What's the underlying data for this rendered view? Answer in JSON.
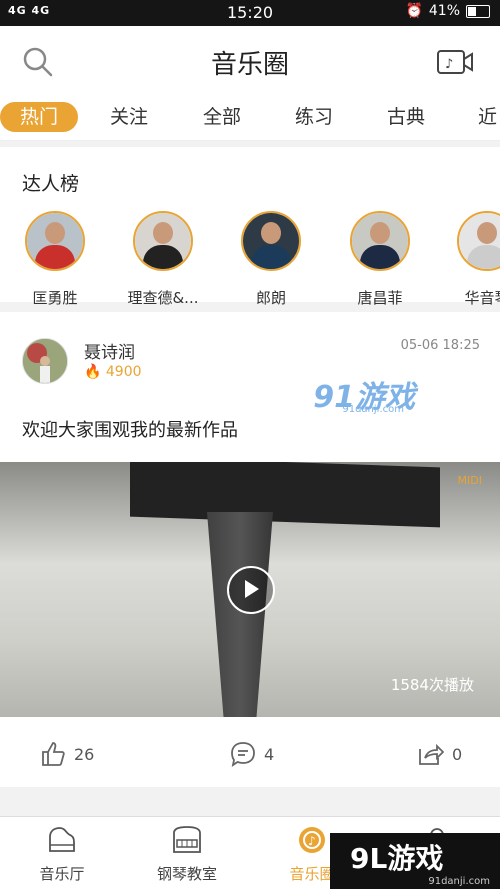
{
  "status": {
    "signal": "4G 4G",
    "time": "15:20",
    "battery": "41%"
  },
  "header": {
    "title": "音乐圈"
  },
  "tabs": [
    "热门",
    "关注",
    "全部",
    "练习",
    "古典",
    "近"
  ],
  "talent": {
    "title": "达人榜",
    "people": [
      {
        "name": "匡勇胜",
        "color": "#c9302c",
        "bg": "#b9c2c8"
      },
      {
        "name": "理查德&...",
        "color": "#222222",
        "bg": "#d8d4cf"
      },
      {
        "name": "郎朗",
        "color": "#1c3a5a",
        "bg": "#2e3b46"
      },
      {
        "name": "唐昌菲",
        "color": "#1c2a44",
        "bg": "#c9c9c4"
      },
      {
        "name": "华音琴",
        "color": "#cccccc",
        "bg": "#e5e5e5"
      }
    ]
  },
  "post": {
    "user": "聂诗润",
    "fire": "4900",
    "time": "05-06 18:25",
    "watermark": "91游戏",
    "watermark_sub": "91danji.com",
    "text": "欢迎大家围观我的最新作品",
    "midi": "MIDI",
    "plays": "1584次播放",
    "likes": "26",
    "comments": "4",
    "shares": "0"
  },
  "bottom_nav": [
    "音乐厅",
    "钢琴教室",
    "音乐圈",
    ""
  ],
  "corner": {
    "big": "9L游戏",
    "small": "91danji.com"
  }
}
